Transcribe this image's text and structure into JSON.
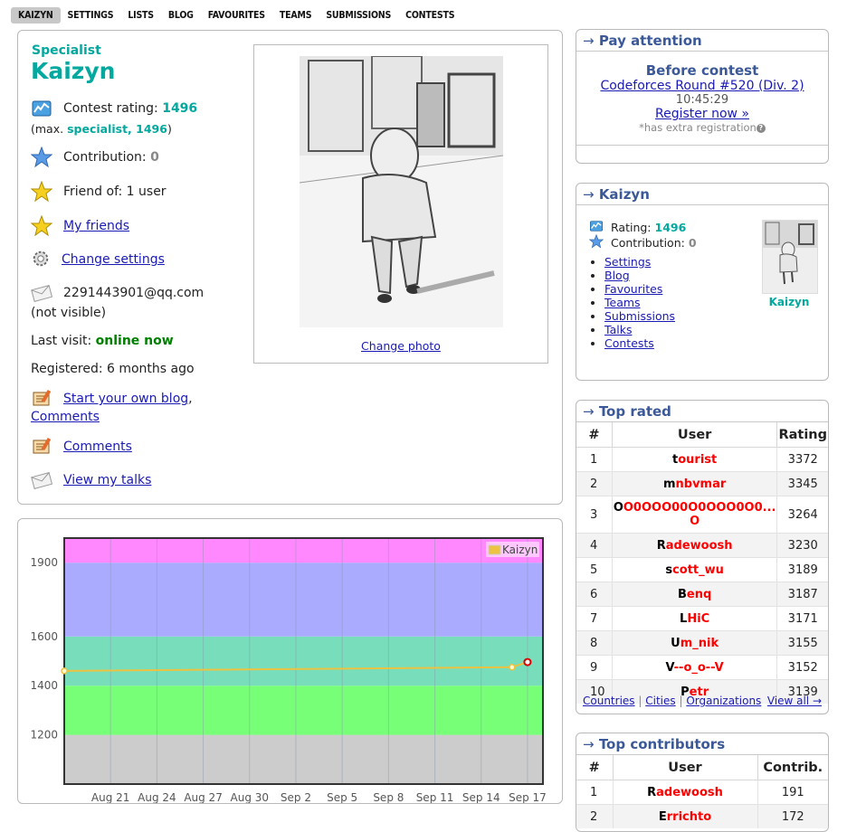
{
  "nav": {
    "tabs": [
      "KAIZYN",
      "SETTINGS",
      "LISTS",
      "BLOG",
      "FAVOURITES",
      "TEAMS",
      "SUBMISSIONS",
      "CONTESTS"
    ],
    "active": "KAIZYN"
  },
  "profile": {
    "rank": "Specialist",
    "handle": "Kaizyn",
    "contest_rating_label": "Contest rating:",
    "contest_rating": "1496",
    "max_prefix": "(max.",
    "max_rank_value": "specialist, 1496",
    "max_suffix": ")",
    "contribution_label": "Contribution:",
    "contribution": "0",
    "friend_of": "Friend of: 1 user",
    "my_friends": "My friends",
    "change_settings": "Change settings",
    "email": "2291443901@qq.com",
    "email_note": "(not visible)",
    "last_visit_label": "Last visit:",
    "last_visit": "online now",
    "registered": "Registered: 6 months ago",
    "start_blog": "Start your own blog",
    "comma": ",",
    "comments_inline": "Comments",
    "comments": "Comments",
    "view_talks": "View my talks",
    "change_photo": "Change photo"
  },
  "pay_attention": {
    "title": "Pay attention",
    "arrow": "→",
    "before": "Before contest",
    "contest": "Codeforces Round #520 (Div. 2)",
    "countdown": "10:45:29",
    "register": "Register now »",
    "extra": "*has extra registration",
    "help_icon": "question-icon"
  },
  "user_box": {
    "title": "Kaizyn",
    "arrow": "→",
    "rating_label": "Rating:",
    "rating": "1496",
    "contribution_label": "Contribution:",
    "contribution": "0",
    "links": [
      "Settings",
      "Blog",
      "Favourites",
      "Teams",
      "Submissions",
      "Talks",
      "Contests"
    ],
    "avatar_caption": "Kaizyn"
  },
  "top_rated": {
    "title": "Top rated",
    "arrow": "→",
    "headers": [
      "#",
      "User",
      "Rating"
    ],
    "rows": [
      {
        "rank": "1",
        "first": "t",
        "rest": "ourist",
        "rating": "3372"
      },
      {
        "rank": "2",
        "first": "m",
        "rest": "nbvmar",
        "rating": "3345"
      },
      {
        "rank": "3",
        "first": "O",
        "rest": "O0OOO00O0OOO0O0...",
        "rest2": "O",
        "rating": "3264"
      },
      {
        "rank": "4",
        "first": "R",
        "rest": "adewoosh",
        "rating": "3230"
      },
      {
        "rank": "5",
        "first": "s",
        "rest": "cott_wu",
        "rating": "3189"
      },
      {
        "rank": "6",
        "first": "B",
        "rest": "enq",
        "rating": "3187"
      },
      {
        "rank": "7",
        "first": "L",
        "rest": "HiC",
        "rating": "3171"
      },
      {
        "rank": "8",
        "first": "U",
        "rest": "m_nik",
        "rating": "3155"
      },
      {
        "rank": "9",
        "first": "V",
        "rest": "--o_o--V",
        "rating": "3152"
      },
      {
        "rank": "10",
        "first": "P",
        "rest": "etr",
        "rating": "3139"
      }
    ],
    "footer_links": [
      "Countries",
      "Cities",
      "Organizations"
    ],
    "sep": "|",
    "view_all": "View all →"
  },
  "top_contributors": {
    "title": "Top contributors",
    "arrow": "→",
    "headers": [
      "#",
      "User",
      "Contrib."
    ],
    "rows": [
      {
        "rank": "1",
        "first": "R",
        "rest": "adewoosh",
        "value": "191"
      },
      {
        "rank": "2",
        "first": "E",
        "rest": "rrichto",
        "value": "172"
      }
    ]
  },
  "chart_data": {
    "type": "line",
    "title": "",
    "xlabel": "",
    "ylabel": "",
    "x_ticks": [
      "Aug 21",
      "Aug 24",
      "Aug 27",
      "Aug 30",
      "Sep 2",
      "Sep 5",
      "Sep 8",
      "Sep 11",
      "Sep 14",
      "Sep 17"
    ],
    "y_ticks": [
      1200,
      1400,
      1600,
      1900
    ],
    "ylim": [
      1000,
      2000
    ],
    "bands": [
      {
        "from": 1000,
        "to": 1200,
        "color": "#cccccc"
      },
      {
        "from": 1200,
        "to": 1400,
        "color": "#77ff77"
      },
      {
        "from": 1400,
        "to": 1600,
        "color": "#77ddbb"
      },
      {
        "from": 1600,
        "to": 1900,
        "color": "#aaaaff"
      },
      {
        "from": 1900,
        "to": 2000,
        "color": "#ff88ff"
      }
    ],
    "legend_position": "top-right",
    "grid": true,
    "series": [
      {
        "name": "Kaizyn",
        "color": "#edc240",
        "points": [
          {
            "x": "Aug 18",
            "y": 1460
          },
          {
            "x": "Sep 16",
            "y": 1475
          },
          {
            "x": "Sep 17",
            "y": 1496
          }
        ]
      }
    ]
  }
}
